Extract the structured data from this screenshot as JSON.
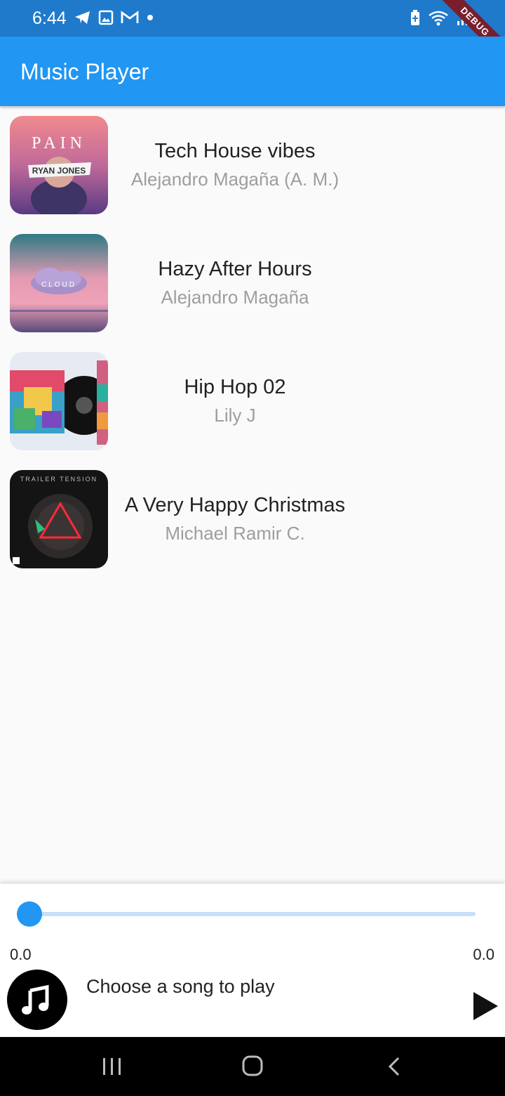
{
  "status_bar": {
    "time": "6:44",
    "left_icons": [
      "telegram-icon",
      "gallery-icon",
      "gmail-icon",
      "dot-icon"
    ],
    "right_icons": [
      "battery-saver-icon",
      "wifi-icon",
      "signal-icon",
      "battery-icon"
    ]
  },
  "debug_banner": "DEBUG",
  "app_bar": {
    "title": "Music Player",
    "color": "#2196f3"
  },
  "songs": [
    {
      "title": "Tech House vibes",
      "artist": "Alejandro Magaña (A. M.)",
      "cover_text": "PAIN",
      "cover_subtext": "RYAN JONES"
    },
    {
      "title": "Hazy After Hours",
      "artist": "Alejandro Magaña",
      "cover_text": "CLOUD"
    },
    {
      "title": "Hip Hop 02",
      "artist": "Lily J"
    },
    {
      "title": "A Very Happy Christmas",
      "artist": "Michael Ramir C.",
      "cover_text": "TRAILER TENSION"
    }
  ],
  "player": {
    "progress": 0.0,
    "time_start": "0.0",
    "time_end": "0.0",
    "now_playing": "Choose a song to play",
    "accent": "#2196f3"
  }
}
